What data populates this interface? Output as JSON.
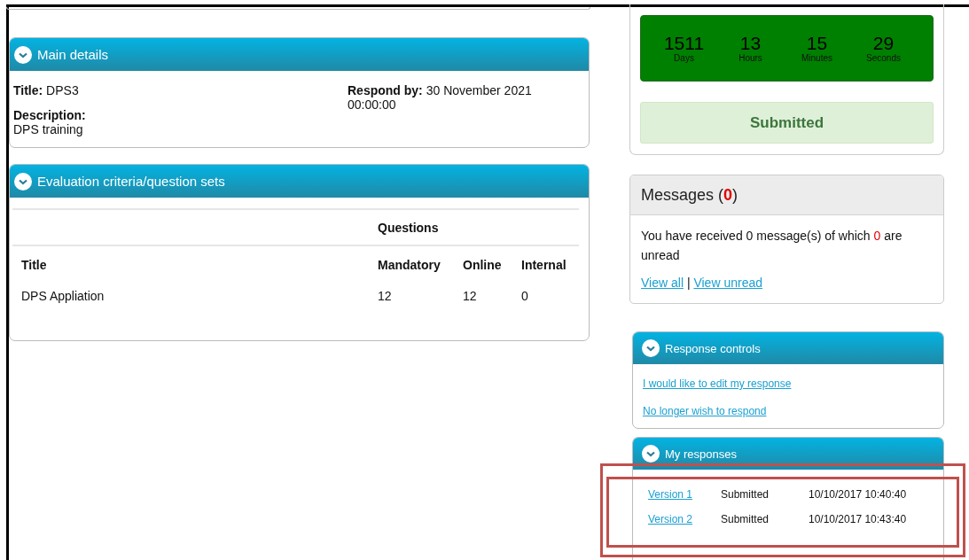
{
  "main_details": {
    "header": "Main details",
    "fields": [
      {
        "kind": "inline",
        "label": "Title:",
        "value": "DPS3"
      },
      {
        "kind": "block",
        "label": "Description:",
        "value": "DPS training"
      }
    ],
    "respond_by": {
      "label": "Respond by:",
      "value": "30 November 2021 00:00:00"
    }
  },
  "evaluation": {
    "header": "Evaluation criteria/question sets",
    "group_heading": "Questions",
    "columns": [
      "Title",
      "Mandatory",
      "Online",
      "Internal"
    ],
    "rows": [
      [
        "DPS Appliation",
        "12",
        "12",
        "0"
      ]
    ]
  },
  "countdown": {
    "units": [
      {
        "value": "1511",
        "unit": "Days"
      },
      {
        "value": "13",
        "unit": "Hours"
      },
      {
        "value": "15",
        "unit": "Minutes"
      },
      {
        "value": "29",
        "unit": "Seconds"
      }
    ],
    "status": "Submitted"
  },
  "messages": {
    "title": "Messages (",
    "count": "0",
    "title_end": ")",
    "text_before": "You have received 0 message(s) of which",
    "unread": "0",
    "text_after": "are unread",
    "links": [
      "View all",
      "View unread"
    ],
    "link_separator": "|"
  },
  "response_controls": {
    "header": "Response controls",
    "links": [
      "I would like to edit my response",
      "No longer wish to respond"
    ]
  },
  "my_responses": {
    "header": "My responses",
    "rows": [
      {
        "version": "Version 1",
        "status": "Submitted",
        "date": "10/10/2017 10:40:40"
      },
      {
        "version": "Version 2",
        "status": "Submitted",
        "date": "10/10/2017 10:43:40"
      }
    ]
  }
}
